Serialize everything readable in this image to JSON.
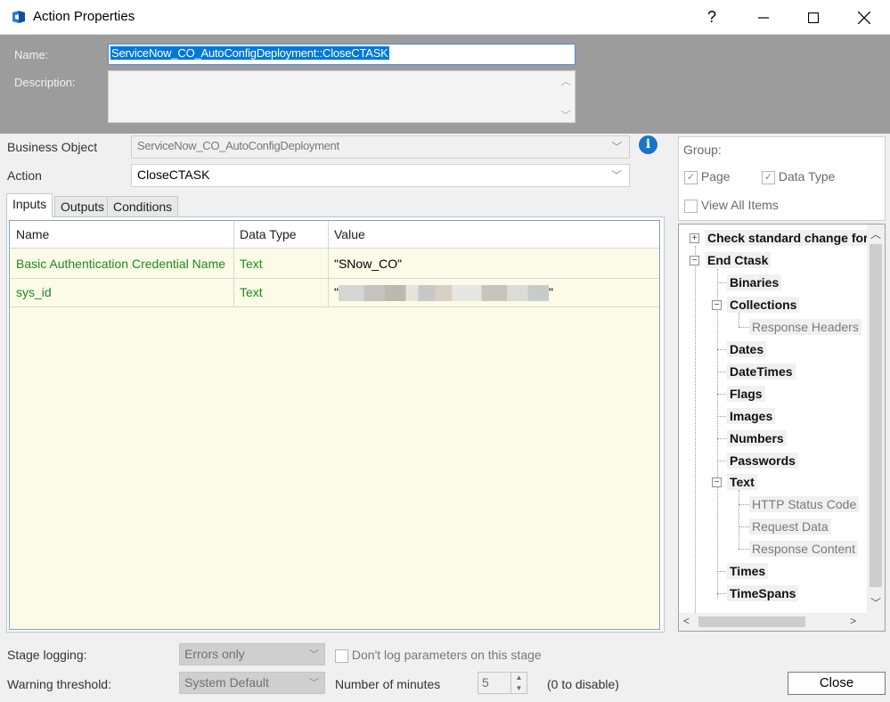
{
  "window": {
    "title": "Action Properties",
    "help": "?"
  },
  "header": {
    "name_label": "Name:",
    "name_value": "ServiceNow_CO_AutoConfigDeployment::CloseCTASK",
    "description_label": "Description:",
    "description_value": ""
  },
  "form": {
    "business_object_label": "Business Object",
    "business_object_value": "ServiceNow_CO_AutoConfigDeployment",
    "action_label": "Action",
    "action_value": "CloseCTASK"
  },
  "tabs": [
    {
      "label": "Inputs",
      "active": true
    },
    {
      "label": "Outputs",
      "active": false
    },
    {
      "label": "Conditions",
      "active": false
    }
  ],
  "grid": {
    "columns": [
      "Name",
      "Data Type",
      "Value"
    ],
    "rows": [
      {
        "name": "Basic Authentication Credential Name",
        "type": "Text",
        "value": "\"SNow_CO\""
      },
      {
        "name": "sys_id",
        "type": "Text",
        "value_prefix": "\"",
        "value_suffix": "\""
      }
    ]
  },
  "group": {
    "label": "Group:",
    "page_label": "Page",
    "page_checked": true,
    "datatype_label": "Data Type",
    "datatype_checked": true,
    "view_all_label": "View All Items",
    "view_all_checked": false
  },
  "tree": {
    "nodes": [
      "Check standard change for",
      "End Ctask",
      "Binaries",
      "Collections",
      "Response Headers",
      "Dates",
      "DateTimes",
      "Flags",
      "Images",
      "Numbers",
      "Passwords",
      "Text",
      "HTTP Status Code",
      "Request Data",
      "Response Content",
      "Times",
      "TimeSpans"
    ]
  },
  "bottom": {
    "stage_logging_label": "Stage logging:",
    "stage_logging_value": "Errors only",
    "dont_log_label": "Don't log parameters on this stage",
    "warning_label": "Warning threshold:",
    "warning_value": "System Default",
    "minutes_label": "Number of minutes",
    "minutes_value": "5",
    "disable_hint": "(0 to disable)",
    "close_label": "Close"
  },
  "colors": {
    "accent": "#0078d7",
    "header_bg": "#9c9c9c",
    "grid_bg": "#fbfbe7",
    "input_text": "#1d8a1d",
    "info": "#1a73c9"
  },
  "icons": [
    "app-icon",
    "help-icon",
    "minimize-icon",
    "maximize-icon",
    "close-icon",
    "info-icon",
    "chevron-down-icon",
    "expand-icon",
    "collapse-icon"
  ]
}
